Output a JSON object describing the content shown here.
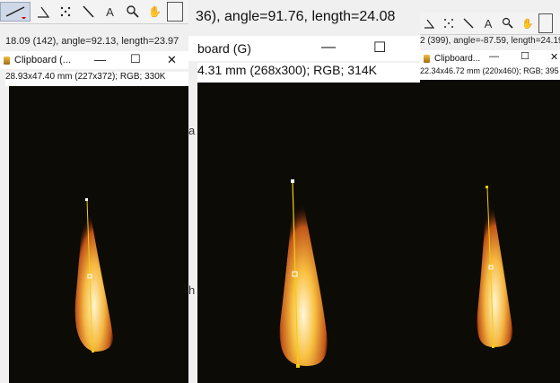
{
  "left_panel": {
    "status_text": "18.09 (142), angle=92.13, length=23.97",
    "window_title": "Clipboard (...",
    "info_text": "28.93x47.40 mm (227x372); RGB; 330K"
  },
  "middle_panel": {
    "status_text": "36), angle=91.76, length=24.08",
    "window_title": "board (G)",
    "info_text": "4.31 mm (268x300); RGB; 314K",
    "side_glyphs": [
      "a",
      "h"
    ]
  },
  "right_panel": {
    "status_text": "2 (399), angle=-87.59, length=24.19",
    "window_title": "Clipboard...",
    "info_text": "22.34x46.72 mm (220x460); RGB; 395"
  },
  "window_controls": {
    "minimize": "—",
    "maximize": "☐",
    "close": "✕"
  },
  "tools": [
    "line-tool",
    "angle-tool",
    "multipoint-tool",
    "wand-tool",
    "text-tool",
    "magnifier-tool",
    "hand-tool",
    "color-picker-tool"
  ],
  "tool_glyphs": {
    "text": "A",
    "magnifier": "🔍",
    "hand": "✋"
  },
  "colors": {
    "flame_core": "#fff3c4",
    "flame_mid": "#f4a020",
    "flame_base": "#a02008",
    "line": "#f2d000",
    "background": "#0d0b06"
  }
}
